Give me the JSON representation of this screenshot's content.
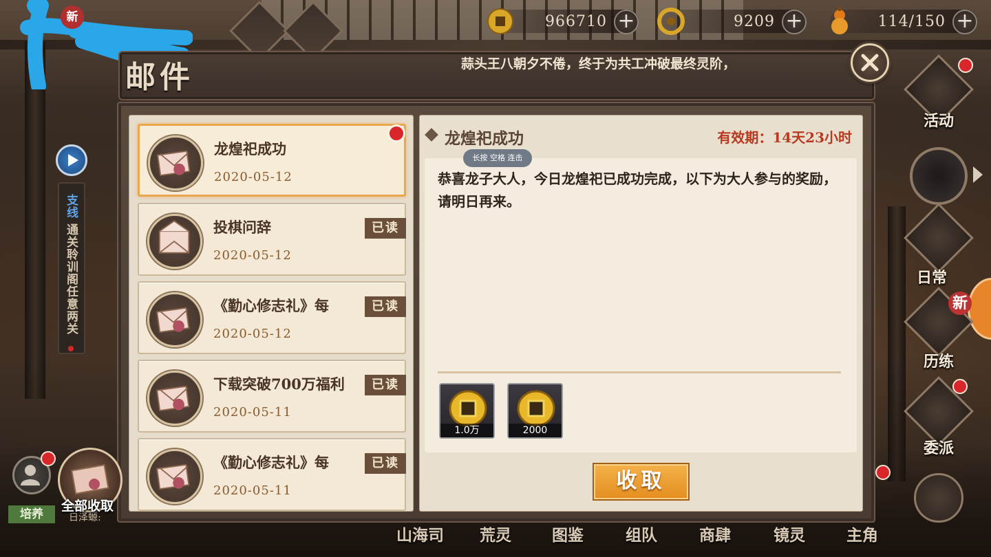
{
  "currencies": [
    {
      "icon": "coin-icon",
      "value": "966710"
    },
    {
      "icon": "jade-token-icon",
      "value": "9209"
    },
    {
      "icon": "gourd-stamina-icon",
      "value": "114/150"
    }
  ],
  "header": {
    "title": "邮件",
    "marquee": "蒜头王八朝夕不倦，终于为共工冲破最终灵阶，"
  },
  "mail_list": [
    {
      "title": "龙煌祀成功",
      "date": "2020-05-12",
      "status": "",
      "selected": true,
      "unread": true
    },
    {
      "title": "投棋问辞",
      "date": "2020-05-12",
      "status": "已读",
      "selected": false,
      "unread": false
    },
    {
      "title": "《勤心修志礼》每",
      "date": "2020-05-12",
      "status": "已读",
      "selected": false,
      "unread": false
    },
    {
      "title": "下载突破700万福利",
      "date": "2020-05-11",
      "status": "已读",
      "selected": false,
      "unread": false
    },
    {
      "title": "《勤心修志礼》每",
      "date": "2020-05-11",
      "status": "已读",
      "selected": false,
      "unread": false
    }
  ],
  "detail": {
    "title": "龙煌祀成功",
    "validity": "有效期：14天23小时",
    "tooltip": "长按 空格 连击",
    "body": "恭喜龙子大人，今日龙煌祀已成功完成，以下为大人参与的奖励，请明日再来。",
    "rewards": [
      {
        "icon": "gold-coin-icon",
        "amount": "1.0万"
      },
      {
        "icon": "gold-coin-icon",
        "amount": "2000"
      }
    ],
    "claim_label": "收取"
  },
  "left": {
    "quest_tag": "支线",
    "quest_text": "通关聆训阁任意两关",
    "claim_all": "全部收取",
    "cultivate": "培养",
    "name_fragment": "日泽螈:",
    "new_badge": "新"
  },
  "right_menu": [
    {
      "label": "活动",
      "icon": "activity-icon"
    },
    {
      "label": "日常",
      "icon": "daily-icon"
    },
    {
      "label": "历练",
      "icon": "training-icon"
    },
    {
      "label": "委派",
      "icon": "dispatch-icon"
    }
  ],
  "right_new_badge": "新",
  "bottom_nav": [
    "山海司",
    "荒灵",
    "图鉴",
    "组队",
    "商肆",
    "镜灵",
    "主角"
  ],
  "colors": {
    "accent_orange": "#e8982f",
    "valid_red": "#b8391f",
    "unread_dot": "#d8262b",
    "panel_brown": "#4a3c32",
    "paper": "#f3e9d6"
  }
}
